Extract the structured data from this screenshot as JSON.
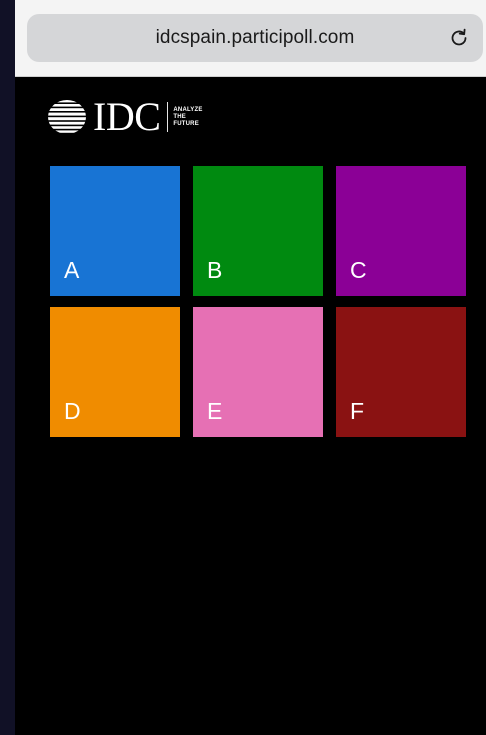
{
  "browser": {
    "url": "idcspain.participoll.com",
    "reload_icon": "reload-icon"
  },
  "logo": {
    "wordmark": "IDC",
    "tagline": [
      "ANALYZE",
      "THE",
      "FUTURE"
    ],
    "globe_icon": "idc-globe-icon"
  },
  "options": [
    {
      "label": "A",
      "color": "#1874d4"
    },
    {
      "label": "B",
      "color": "#008a10"
    },
    {
      "label": "C",
      "color": "#8b0096"
    },
    {
      "label": "D",
      "color": "#f08c00"
    },
    {
      "label": "E",
      "color": "#e670b4"
    },
    {
      "label": "F",
      "color": "#8a1212"
    }
  ]
}
